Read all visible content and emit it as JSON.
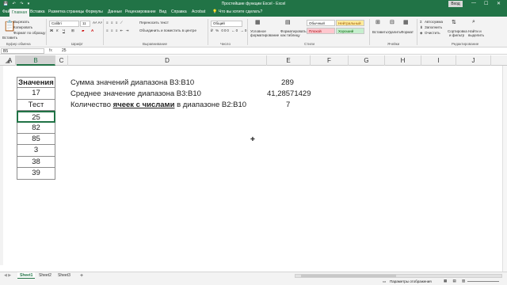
{
  "titlebar": {
    "title": "Простейшие функции Excel  -  Excel",
    "login": "Вход",
    "qat": "💾 ↶ ↷ ▾",
    "min": "—",
    "max": "☐",
    "close": "✕"
  },
  "tabs": {
    "file": "Файл",
    "home": "Главная",
    "insert": "Вставка",
    "layout": "Разметка страницы",
    "formulas": "Формулы",
    "data": "Данные",
    "review": "Рецензирование",
    "view": "Вид",
    "help": "Справка",
    "acrobat": "Acrobat",
    "tell": "Что вы хотите сделать?"
  },
  "ribbon": {
    "cut": "Вырезать",
    "copy": "Копировать",
    "format_painter": "Формат по образцу",
    "paste": "Вставить",
    "clipboard": "Буфер обмена",
    "font_name": "Calibri",
    "font_size": "11",
    "bold": "Ж",
    "italic": "К",
    "underline": "Ч",
    "font_group": "Шрифт",
    "wrap": "Переносить текст",
    "merge": "Объединить и поместить в центре",
    "alignment_group": "Выравнивание",
    "number_format": "Общий",
    "number_group": "Число",
    "conditional": "Условное",
    "conditional2": "форматирование",
    "format_table": "Форматировать",
    "format_table2": "как таблицу",
    "style_normal": "Обычный",
    "style_neutral": "Нейтральный",
    "style_bad": "Плохой",
    "style_good": "Хороший",
    "styles_group": "Стили",
    "insert": "Вставить",
    "delete": "Удалить",
    "format": "Формат",
    "cells_group": "Ячейки",
    "autosum": "Автосумма",
    "fill": "Заполнить",
    "clear": "Очистить",
    "sort": "Сортировка",
    "sort2": "и фильтр",
    "find": "Найти и",
    "find2": "выделить",
    "editing_group": "Редактирование"
  },
  "formula_bar": {
    "name_box": "B5",
    "fx": "fx",
    "value": "25"
  },
  "columns": [
    "A",
    "B",
    "C",
    "D",
    "E",
    "F",
    "G",
    "H",
    "I",
    "J"
  ],
  "table_b": [
    "Значения",
    "17",
    "Тест",
    "25",
    "82",
    "85",
    "3",
    "38",
    "39"
  ],
  "labels": {
    "sum": "Сумма значений диапазона B3:B10",
    "avg": "Среднее значение диапазона B3:B10",
    "count_prefix": "Количество ",
    "count_bold": "ячеек с числами",
    "count_suffix": " в диапазоне B2:B10"
  },
  "results": {
    "sum": "289",
    "avg": "41,28571429",
    "count": "7"
  },
  "sheets": [
    "Sheet1",
    "Sheet2",
    "Sheet3"
  ],
  "add_sheet": "+",
  "status": {
    "display_settings": "Параметры отображения"
  }
}
